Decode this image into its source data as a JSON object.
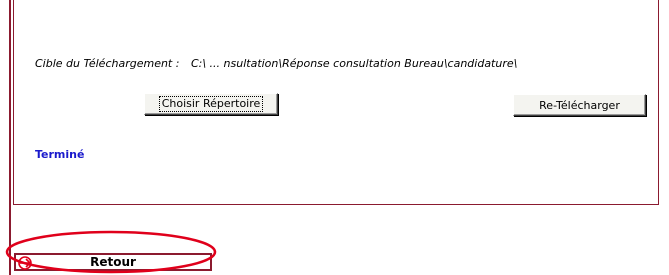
{
  "download": {
    "label": "Cible du Téléchargement :",
    "path": "C:\\ ... nsultation\\Réponse consultation Bureau\\candidature\\"
  },
  "buttons": {
    "choose_dir": "Choisir Répertoire",
    "redownload": "Re-Télécharger"
  },
  "status": "Terminé",
  "nav": {
    "back_label": "Retour",
    "back_icon": "arrow-right-icon"
  },
  "colors": {
    "border": "#8b1a2f",
    "status_text": "#1a1acc",
    "annotation": "#e0001b"
  }
}
